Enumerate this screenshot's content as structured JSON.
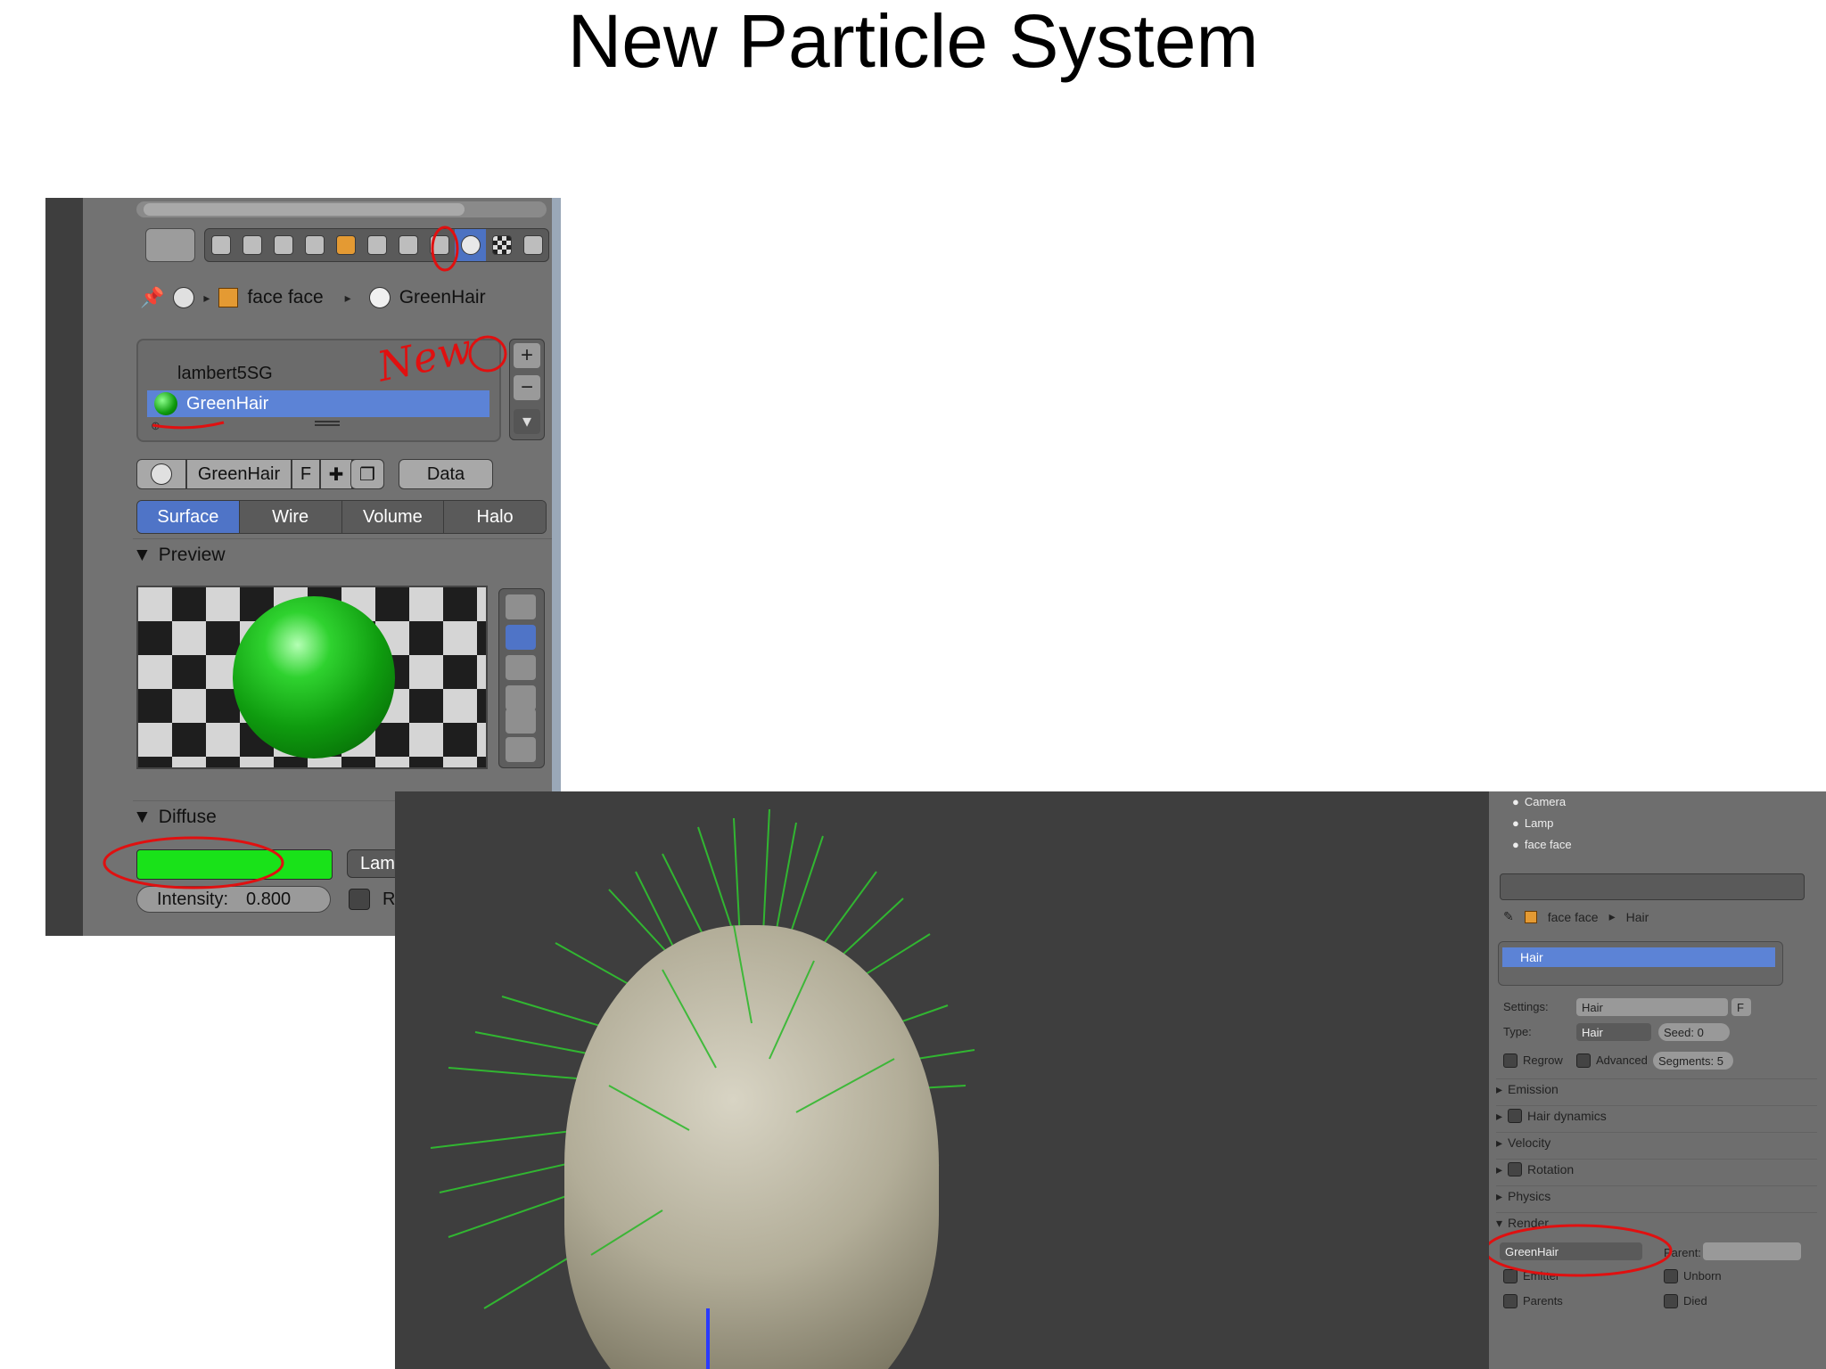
{
  "slide": {
    "title": "New Particle System"
  },
  "material_panel": {
    "breadcrumb": {
      "object": "face face",
      "material": "GreenHair"
    },
    "slots": [
      "lambert5SG",
      "GreenHair"
    ],
    "slot_buttons": {
      "add": "+",
      "remove": "−",
      "menu": "▾"
    },
    "datablock": {
      "name": "GreenHair",
      "fake_user": "F",
      "link": "Data"
    },
    "type_tabs": [
      "Surface",
      "Wire",
      "Volume",
      "Halo"
    ],
    "active_type_tab": "Surface",
    "preview": {
      "header": "Preview"
    },
    "diffuse": {
      "header": "Diffuse",
      "color": "#19e219",
      "shader": "Lambert",
      "intensity_label": "Intensity:",
      "intensity_value": "0.800",
      "ramp_label": "Ramp"
    },
    "annotation": "New"
  },
  "particle_panel": {
    "outliner": [
      "Camera",
      "Lamp",
      "face face"
    ],
    "breadcrumb": {
      "object": "face face",
      "system": "Hair"
    },
    "system_name": "Hair",
    "settings_label": "Settings:",
    "settings_value": "Hair",
    "settings_fake_user": "F",
    "type_label": "Type:",
    "type_value": "Hair",
    "seed_label": "Seed:",
    "seed_value": "0",
    "regrow_label": "Regrow",
    "advanced_label": "Advanced",
    "segments_label": "Segments: 5",
    "sections": [
      "Emission",
      "Hair dynamics",
      "Velocity",
      "Rotation",
      "Physics",
      "Render"
    ],
    "render_material": "GreenHair",
    "parent_label": "Parent:",
    "emitter_label": "Emitter",
    "unborn_label": "Unborn",
    "parents_label": "Parents",
    "died_label": "Died"
  }
}
